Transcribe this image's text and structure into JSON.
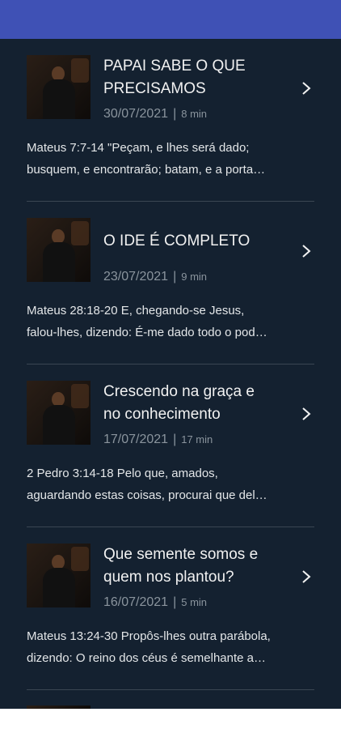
{
  "colors": {
    "appbar": "#3f51b5",
    "background": "#142130",
    "title": "#f1f1f1",
    "meta": "#8a949d"
  },
  "sermons": [
    {
      "title_line1": "PAPAI SABE O QUE",
      "title_line2": "PRECISAMOS",
      "date": "30/07/2021",
      "duration": "8 min",
      "desc_line1": "Mateus 7:7-14 \"Peçam, e lhes será dado;",
      "desc_line2": "busquem, e encontrarão; batam, e a porta…"
    },
    {
      "title_line1": "O IDE É COMPLETO",
      "title_line2": "",
      "date": "23/07/2021",
      "duration": "9 min",
      "desc_line1": "Mateus 28:18-20 E, chegando-se Jesus,",
      "desc_line2": "falou-lhes, dizendo: É-me dado todo o pod…"
    },
    {
      "title_line1": "Crescendo na graça e",
      "title_line2": "no conhecimento",
      "date": "17/07/2021",
      "duration": "17 min",
      "desc_line1": "2 Pedro 3:14-18 Pelo que, amados,",
      "desc_line2": "aguardando estas coisas, procurai que del…"
    },
    {
      "title_line1": "Que semente somos e",
      "title_line2": "quem nos plantou?",
      "date": "16/07/2021",
      "duration": "5 min",
      "desc_line1": "Mateus 13:24-30 Propôs-lhes outra parábola,",
      "desc_line2": "dizendo: O reino dos céus é semelhante a…"
    }
  ]
}
